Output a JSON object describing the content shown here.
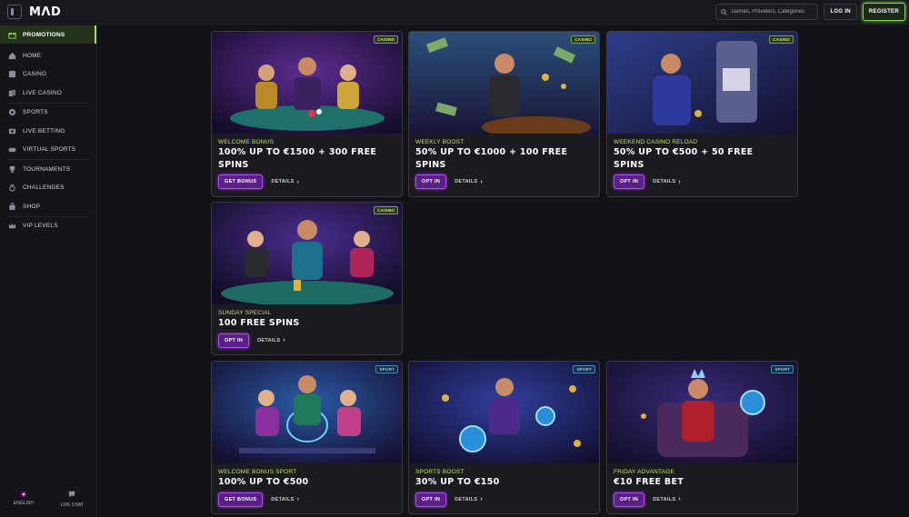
{
  "header": {
    "logo": "MΛD",
    "search_placeholder": "Games, Providers, Categories",
    "login_label": "LOG IN",
    "register_label": "REGISTER"
  },
  "sidebar": {
    "items": [
      {
        "label": "PROMOTIONS",
        "icon": "gift-icon",
        "active": true
      },
      {
        "label": "HOME",
        "icon": "home-icon"
      },
      {
        "label": "CASINO",
        "icon": "casino-icon"
      },
      {
        "label": "LIVE CASINO",
        "icon": "cards-icon"
      },
      {
        "label": "SPORTS",
        "icon": "ball-icon"
      },
      {
        "label": "LIVE BETTING",
        "icon": "live-icon"
      },
      {
        "label": "VIRTUAL SPORTS",
        "icon": "gamepad-icon"
      },
      {
        "label": "TOURNAMENTS",
        "icon": "trophy-icon"
      },
      {
        "label": "CHALLENGES",
        "icon": "medal-icon"
      },
      {
        "label": "SHOP",
        "icon": "bag-icon"
      },
      {
        "label": "VIP LEVELS",
        "icon": "crown-icon"
      }
    ],
    "language_label": "ENGLISH",
    "live_chat_label": "LIVE CHAT"
  },
  "colors": {
    "accent_green": "#9be15d",
    "cta_purple": "#5b1f88",
    "background": "#131217"
  },
  "promotions": [
    {
      "badge": "CASINO",
      "subtitle": "WELCOME BONUS",
      "title_line1": "100% UP TO €1500 + 300 FREE",
      "title_line2": "SPINS",
      "cta": "GET BONUS",
      "details": "DETAILS"
    },
    {
      "badge": "CASINO",
      "subtitle": "WEEKLY BOOST",
      "title_line1": "50% UP TO €1000 + 100 FREE",
      "title_line2": "SPINS",
      "cta": "OPT IN",
      "details": "DETAILS"
    },
    {
      "badge": "CASINO",
      "subtitle": "WEEKEND CASINO RELOAD",
      "title_line1": "50% UP TO €500 + 50 FREE",
      "title_line2": "SPINS",
      "cta": "OPT IN",
      "details": "DETAILS"
    },
    {
      "badge": "CASINO",
      "subtitle": "SUNDAY SPECIAL",
      "title_line1": "100 FREE SPINS",
      "title_line2": "",
      "cta": "OPT IN",
      "details": "DETAILS"
    },
    {
      "badge": "SPORT",
      "subtitle": "WELCOME BONUS SPORT",
      "title_line1": "100% UP TO €500",
      "title_line2": "",
      "cta": "GET BONUS",
      "details": "DETAILS"
    },
    {
      "badge": "SPORT",
      "subtitle": "SPORTS BOOST",
      "title_line1": "30% UP TO €150",
      "title_line2": "",
      "cta": "OPT IN",
      "details": "DETAILS"
    },
    {
      "badge": "SPORT",
      "subtitle": "FRIDAY ADVANTAGE",
      "title_line1": "€10 FREE BET",
      "title_line2": "",
      "cta": "OPT IN",
      "details": "DETAILS"
    }
  ]
}
